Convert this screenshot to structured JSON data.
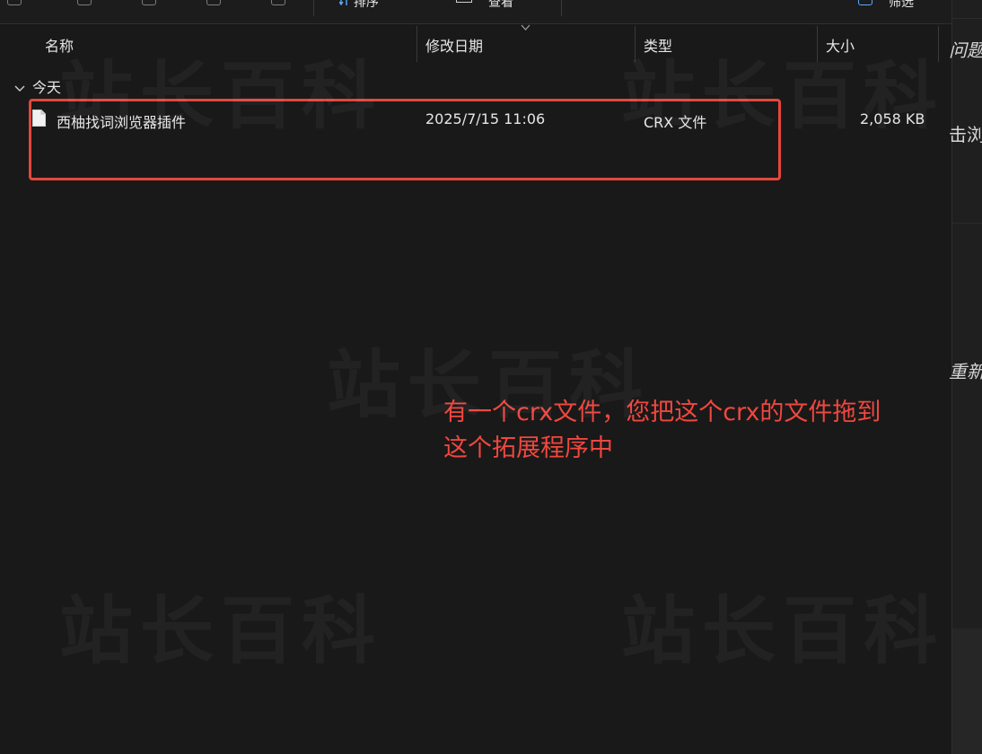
{
  "toolbar": {
    "sort_label": "排序",
    "view_label": "查看",
    "more_label": "筛选"
  },
  "columns": [
    {
      "label": "名称"
    },
    {
      "label": "修改日期"
    },
    {
      "label": "类型"
    },
    {
      "label": "大小"
    }
  ],
  "group": {
    "label": "今天"
  },
  "files": [
    {
      "name": "西柚找词浏览器插件",
      "modified": "2025/7/15 11:06",
      "type": "CRX 文件",
      "size": "2,058 KB"
    }
  ],
  "annotation": {
    "line1": "有一个crx文件，您把这个crx的文件拖到",
    "line2": "这个拓展程序中"
  },
  "right_panel": {
    "text1": "问题",
    "text2": "击浏",
    "text3": "重新"
  },
  "watermark": {
    "text": "站长百科"
  },
  "colors": {
    "highlight": "#e4473d",
    "annotation": "#f0473f",
    "background": "#191919"
  }
}
